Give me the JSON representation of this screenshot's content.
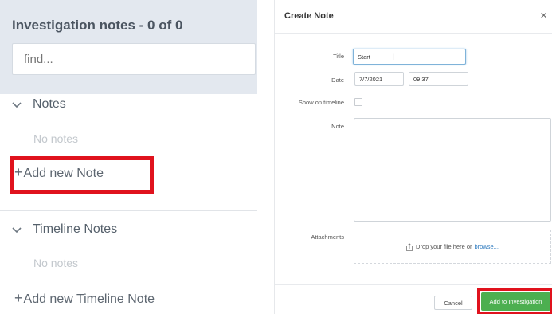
{
  "left_panel": {
    "title": "Investigation notes - 0 of 0",
    "find_placeholder": "find...",
    "notes_section": {
      "heading": "Notes",
      "empty_text": "No notes",
      "add_label": "Add new Note"
    },
    "timeline_section": {
      "heading": "Timeline Notes",
      "empty_text": "No notes",
      "add_label": "Add new Timeline Note"
    },
    "plus_glyph": "+",
    "chevron_icon": "chevron-down-icon"
  },
  "modal": {
    "title": "Create Note",
    "close_glyph": "×",
    "fields": {
      "title_label": "Title",
      "title_value": "Start",
      "date_label": "Date",
      "date_value": "7/7/2021",
      "time_value": "09:37",
      "show_on_timeline_label": "Show on timeline",
      "show_on_timeline_checked": false,
      "note_label": "Note",
      "note_value": "",
      "attachments_label": "Attachments",
      "drop_text": "Drop your file here or",
      "browse_text": "browse..."
    },
    "buttons": {
      "cancel": "Cancel",
      "add": "Add to Investigation"
    }
  },
  "colors": {
    "highlight": "#e0121d",
    "primary_button": "#4caf50",
    "link": "#2f7bbf",
    "header_bg": "#e3e8ef"
  }
}
